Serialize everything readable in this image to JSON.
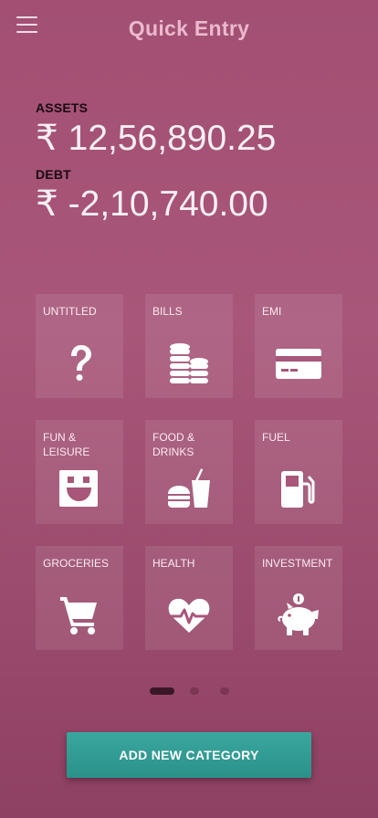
{
  "header": {
    "title": "Quick Entry",
    "menu_icon": "hamburger-menu-icon"
  },
  "summary": {
    "assets_label": "ASSETS",
    "assets_amount": "₹ 12,56,890.25",
    "debt_label": "DEBT",
    "debt_amount": "₹ -2,10,740.00"
  },
  "categories": [
    {
      "label": "UNTITLED",
      "icon": "question-mark-icon"
    },
    {
      "label": "BILLS",
      "icon": "coins-stack-icon"
    },
    {
      "label": "EMI",
      "icon": "credit-card-icon"
    },
    {
      "label": "FUN & LEISURE",
      "icon": "smiley-face-icon"
    },
    {
      "label": "FOOD & DRINKS",
      "icon": "burger-drink-icon"
    },
    {
      "label": "FUEL",
      "icon": "fuel-pump-icon"
    },
    {
      "label": "GROCERIES",
      "icon": "shopping-cart-icon"
    },
    {
      "label": "HEALTH",
      "icon": "heartbeat-icon"
    },
    {
      "label": "INVESTMENT",
      "icon": "piggy-bank-icon"
    }
  ],
  "pager": {
    "page_count": 3,
    "active_page": 1
  },
  "actions": {
    "add_category_label": "ADD NEW CATEGORY"
  },
  "colors": {
    "accent_button": "#2f9b92",
    "background": "#a24f73",
    "title": "#ebb9cd"
  }
}
